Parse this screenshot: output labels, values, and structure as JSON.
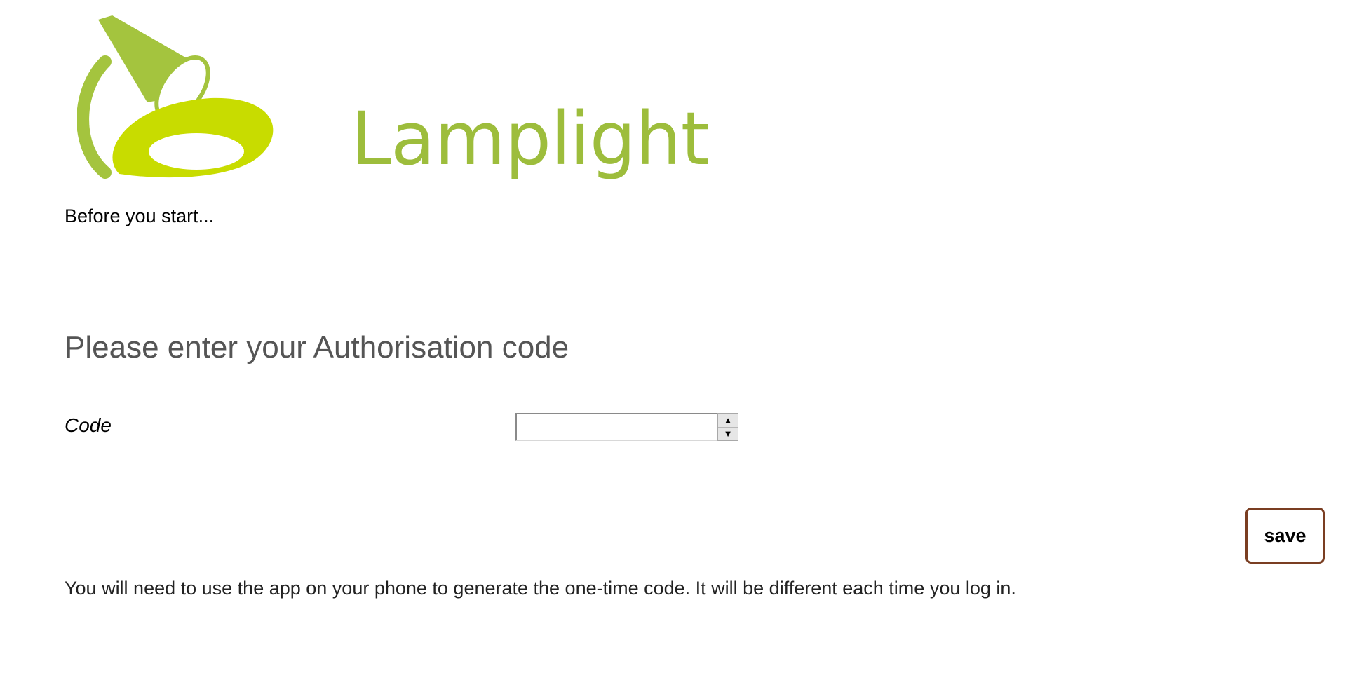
{
  "logo": {
    "text": "Lamplight",
    "color": "#9dbd3c",
    "accent_color": "#c8dc00"
  },
  "intro": "Before you start...",
  "heading": "Please enter your Authorisation code",
  "form": {
    "code_label": "Code",
    "code_value": "",
    "save_label": "save"
  },
  "help_text": "You will need to use the app on your phone to generate the one-time code. It will be different each time you log in."
}
